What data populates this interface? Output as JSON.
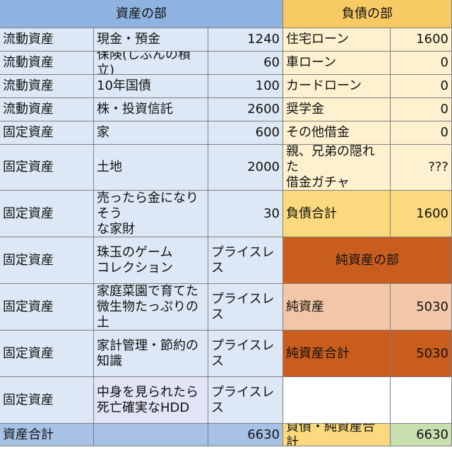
{
  "assets_header": "資産の部",
  "liabilities_header": "負債の部",
  "assets": [
    {
      "type": "流動資産",
      "item": "現金・預金",
      "value": "1240"
    },
    {
      "type": "流動資産",
      "item": "保険(じぶんの積立)",
      "value": "60"
    },
    {
      "type": "流動資産",
      "item": "10年国債",
      "value": "100"
    },
    {
      "type": "流動資産",
      "item": "株・投資信託",
      "value": "2600"
    },
    {
      "type": "固定資産",
      "item": "家",
      "value": "600"
    },
    {
      "type": "固定資産",
      "item": "土地",
      "value": "2000"
    },
    {
      "type": "固定資産",
      "item": "売ったら金になりそう\nな家財",
      "value": "30"
    },
    {
      "type": "固定資産",
      "item": "珠玉のゲーム\nコレクション",
      "value": "プライスレス"
    },
    {
      "type": "固定資産",
      "item": "家庭菜園で育てた\n微生物たっぷりの土",
      "value": "プライスレス"
    },
    {
      "type": "固定資産",
      "item": "家計管理・節約の\n知識",
      "value": "プライスレス"
    },
    {
      "type": "固定資産",
      "item": "中身を見られたら\n死亡確実なHDD",
      "value": "プライスレス"
    }
  ],
  "liabilities": [
    {
      "item": "住宅ローン",
      "value": "1600"
    },
    {
      "item": "車ローン",
      "value": "0"
    },
    {
      "item": "カードローン",
      "value": "0"
    },
    {
      "item": "奨学金",
      "value": "0"
    },
    {
      "item": "その他借金",
      "value": "0"
    },
    {
      "item": "親、兄弟の隠れた\n借金ガチャ",
      "value": "???"
    }
  ],
  "liabilities_total": {
    "label": "負債合計",
    "value": "1600"
  },
  "net_assets_header": "純資産の部",
  "net_assets": {
    "label": "純資産",
    "value": "5030"
  },
  "net_assets_total": {
    "label": "純資産合計",
    "value": "5030"
  },
  "assets_total": {
    "label": "資産合計",
    "value": "6630"
  },
  "grand_total": {
    "label": "負債・純資産合計",
    "value": "6630"
  }
}
